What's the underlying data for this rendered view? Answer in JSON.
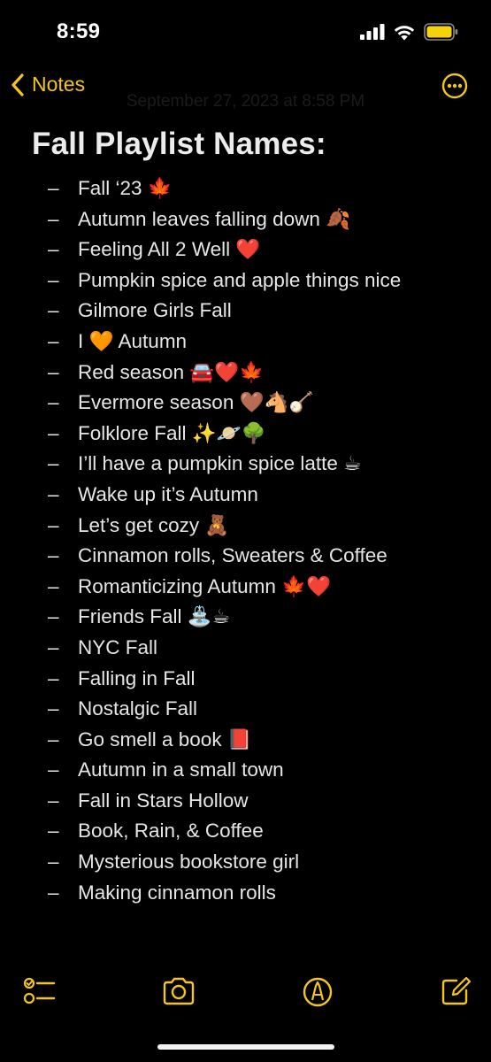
{
  "status_bar": {
    "time": "8:59"
  },
  "nav": {
    "back_label": "Notes",
    "back_icon": "chevron-left-icon",
    "more_icon": "ellipsis-circle-icon"
  },
  "note": {
    "date": "September 27, 2023 at 8:58 PM",
    "title": "Fall Playlist Names:",
    "bullet": "–",
    "items": [
      "Fall ‘23 🍁",
      "Autumn leaves falling down 🍂",
      "Feeling All 2 Well ❤️",
      "Pumpkin spice and apple things nice",
      "Gilmore Girls Fall",
      "I 🧡 Autumn",
      "Red season 🚘❤️🍁",
      "Evermore season 🤎🐴🪕",
      "Folklore Fall ✨🪐🌳",
      "I’ll have a pumpkin spice latte ☕",
      "Wake up it’s Autumn",
      "Let’s get cozy 🧸",
      "Cinnamon rolls, Sweaters & Coffee",
      "Romanticizing Autumn 🍁❤️",
      "Friends Fall ⛲☕",
      "NYC Fall",
      "Falling in Fall",
      "Nostalgic Fall",
      "Go smell a book 📕",
      "Autumn in a small town",
      "Fall in Stars Hollow",
      "Book, Rain, & Coffee",
      "Mysterious bookstore girl",
      "Making cinnamon rolls"
    ]
  },
  "toolbar": {
    "checklist_icon": "checklist-icon",
    "camera_icon": "camera-icon",
    "markup_icon": "markup-pen-icon",
    "compose_icon": "compose-icon"
  },
  "colors": {
    "accent": "#f5c518",
    "background": "#000000",
    "text": "#e6e6e6"
  }
}
